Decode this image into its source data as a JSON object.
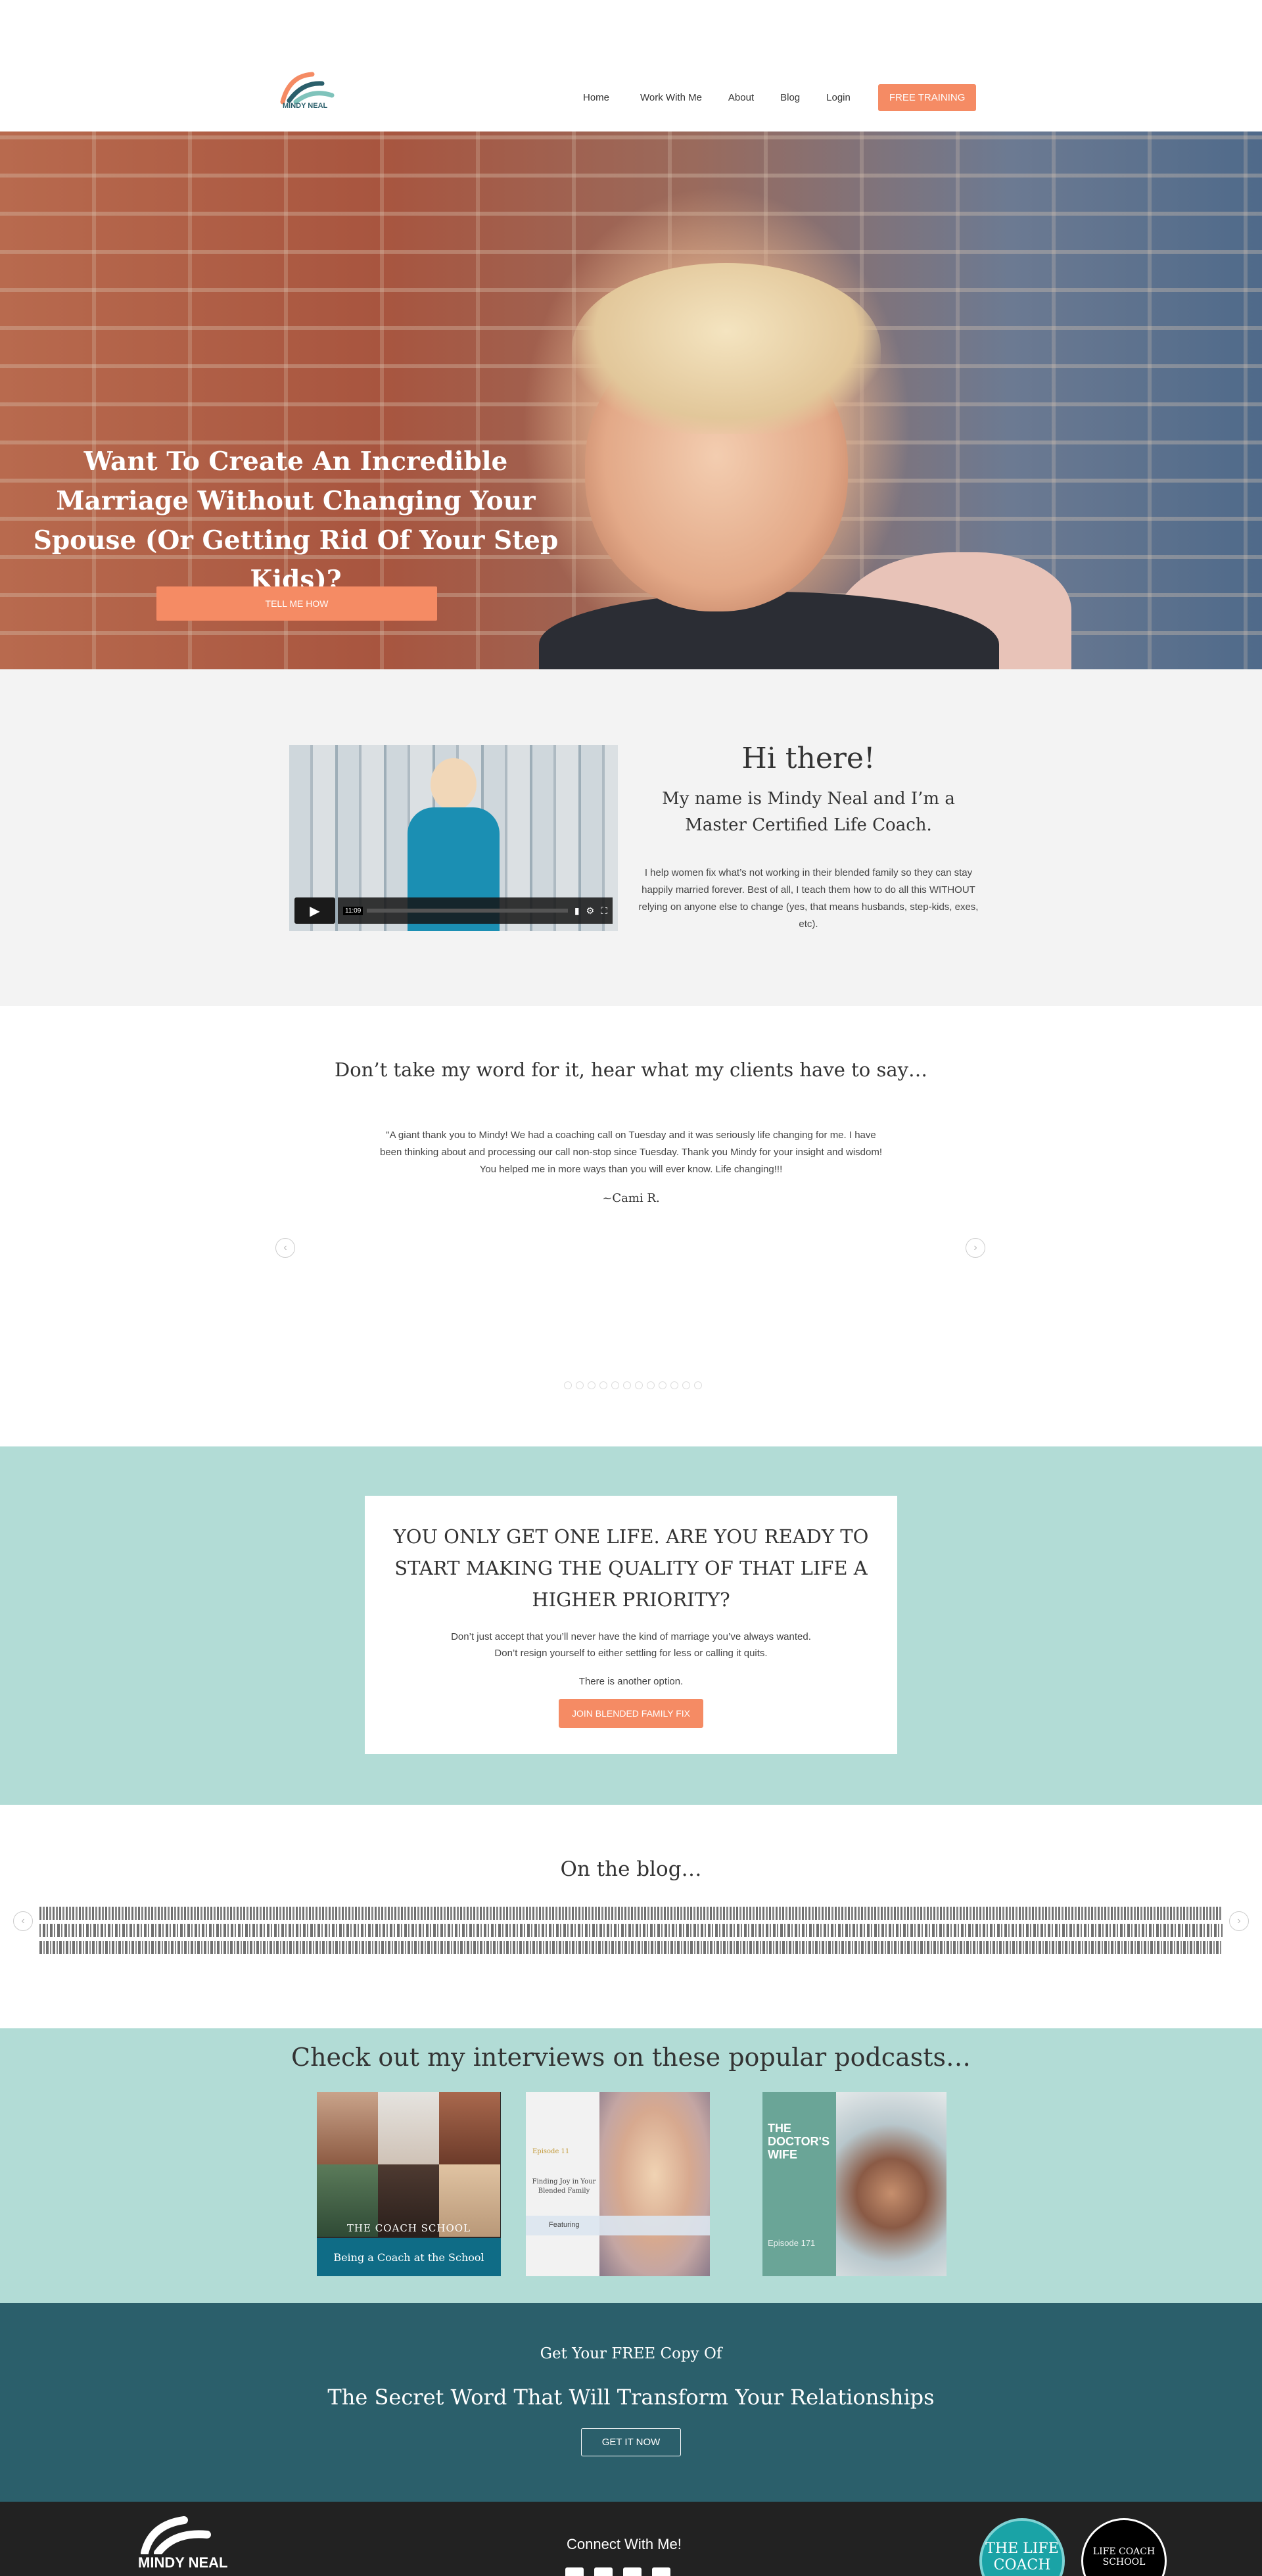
{
  "header": {
    "logo_text": "MINDY NEAL",
    "nav": [
      "Home",
      "Work With Me",
      "About",
      "Blog",
      "Login"
    ],
    "cta_label": "FREE TRAINING"
  },
  "hero": {
    "title": "Want To Create An Incredible Marriage Without Changing Your Spouse (Or Getting Rid Of Your Step Kids)?",
    "button_label": "TELL ME HOW"
  },
  "intro": {
    "video_time": "11:09",
    "heading": "Hi there!",
    "subheading": "My name is Mindy Neal and I’m a Master Certified Life Coach.",
    "body": "I help women fix what’s not working in their blended family so they can stay happily married forever. Best of all, I teach them how to do all this WITHOUT relying on anyone else to change (yes, that means husbands, step-kids, exes, etc)."
  },
  "testimonials": {
    "heading": "Don’t take my word for it, hear what my clients have to say…",
    "quote": "\"A giant thank you to Mindy! We had a coaching call on Tuesday and it was seriously life changing for me. I have been thinking about and processing our call non-stop since Tuesday. Thank you Mindy for your insight and wisdom! You helped me in more ways than you will ever know. Life changing!!!",
    "author": "~Cami R.",
    "prev_icon": "chevron-left-icon",
    "next_icon": "chevron-right-icon",
    "dot_count": 12
  },
  "cta": {
    "heading": "YOU ONLY GET ONE LIFE. ARE YOU READY TO START MAKING THE QUALITY OF THAT LIFE A HIGHER PRIORITY?",
    "line1": "Don’t just accept that you’ll never have the kind of marriage you’ve always wanted.",
    "line2": "Don’t resign yourself to either settling for less or calling it quits.",
    "line3": "There is another option.",
    "button_label": "JOIN BLENDED FAMILY FIX"
  },
  "blog": {
    "heading": "On the blog…"
  },
  "podcasts": {
    "heading": "Check out my interviews on these popular podcasts…",
    "pod1_school": "THE COACH SCHOOL",
    "pod1_title": "Being a Coach at the School",
    "pod2_episode": "Episode 11",
    "pod2_title": "Finding Joy in Your Blended Family",
    "pod2_featuring": "Featuring",
    "pod3_title": "THE DOCTOR'S WIFE",
    "pod3_episode": "Episode 171"
  },
  "freecopy": {
    "kicker": "Get Your FREE Copy Of",
    "title": "The Secret Word That Will Transform Your Relationships",
    "button_label": "GET IT NOW"
  },
  "footer": {
    "logo_text": "MINDY NEAL",
    "connect": "Connect With Me!",
    "badge1": "THE LIFE COACH",
    "badge2": "LIFE COACH SCHOOL"
  },
  "colors": {
    "accent": "#f58b64",
    "teal_light": "#b2dcd6",
    "teal_dark": "#2b5f6b"
  }
}
